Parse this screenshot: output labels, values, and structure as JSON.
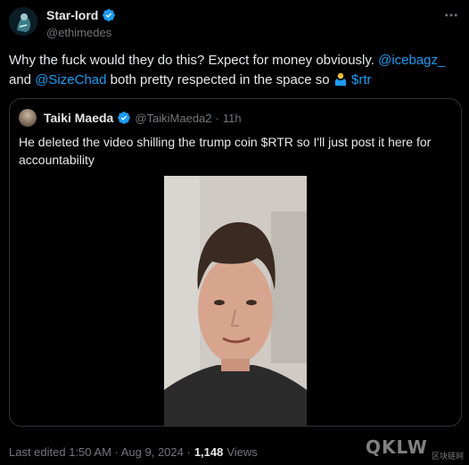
{
  "tweet": {
    "author_name": "Star-lord",
    "author_handle": "@ethimedes",
    "more_icon": "more-horizontal-icon",
    "text_part1": "Why the fuck would they do this? Expect for money obviously. ",
    "mention1": "@icebagz_",
    "text_part2": "and ",
    "mention2": "@SizeChad",
    "text_part3": " both pretty respected in the space so ",
    "emoji": "person-shrugging",
    "cashtag": "$rtr"
  },
  "quote": {
    "author_name": "Taiki Maeda",
    "author_handle": "@TaikiMaeda2",
    "separator": "·",
    "time": "11h",
    "text": "He deleted the video shilling the trump coin $RTR so I'll just post it here for accountability"
  },
  "footer": {
    "edited": "Last edited 1:50 AM · Aug 9, 2024 ·",
    "views_count": "1,148",
    "views_label": "Views"
  },
  "watermark": {
    "logo": "QKLW",
    "text": "区块链网"
  },
  "colors": {
    "background": "#000000",
    "link": "#1d9bf0",
    "muted": "#71767b",
    "verified": "#1d9bf0"
  }
}
